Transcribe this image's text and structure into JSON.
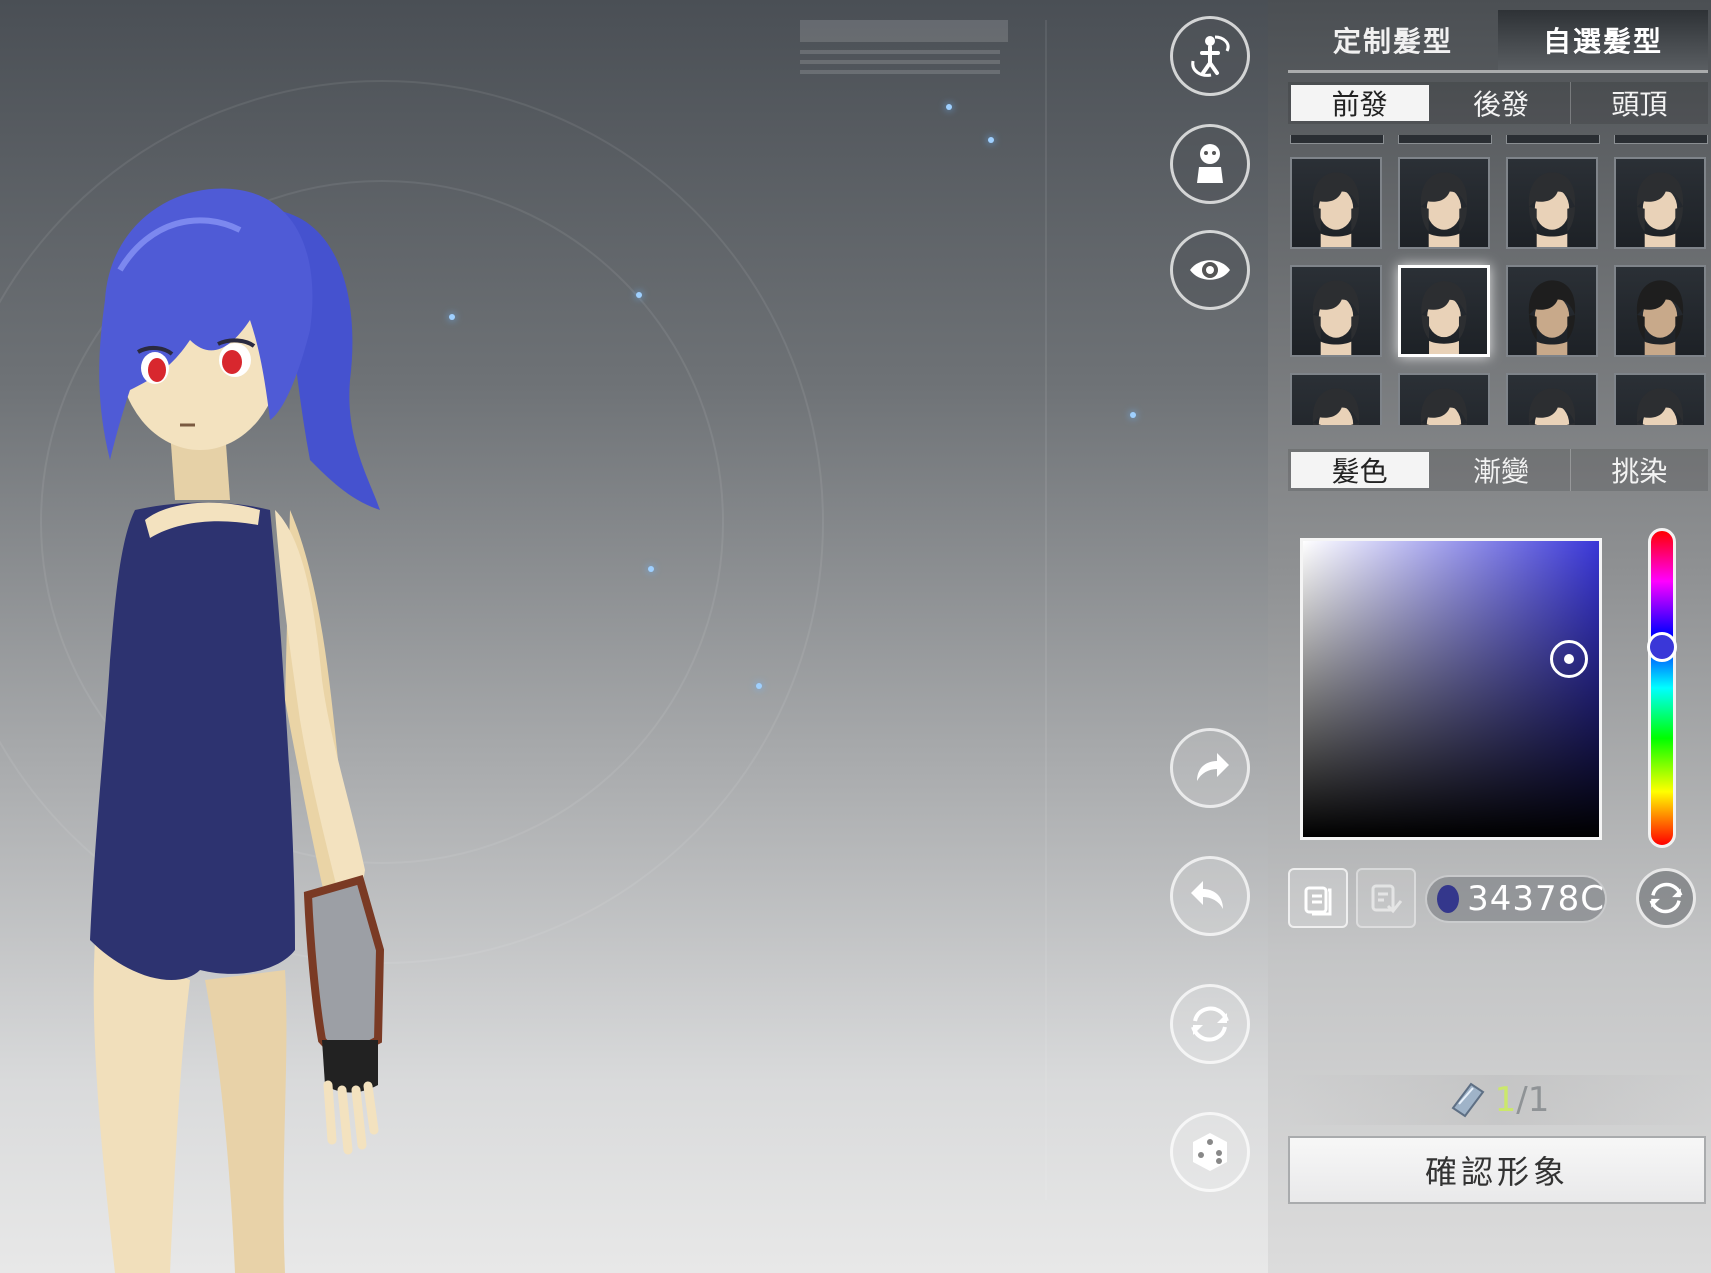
{
  "panel": {
    "top_tabs": [
      {
        "label": "定制髮型",
        "active": false
      },
      {
        "label": "自選髮型",
        "active": true
      }
    ],
    "part_tabs": [
      {
        "label": "前發",
        "active": true
      },
      {
        "label": "後發",
        "active": false
      },
      {
        "label": "頭頂",
        "active": false
      }
    ],
    "hairstyles": {
      "visible_rows": 2,
      "per_row": 4,
      "selected_index": 5,
      "styles": [
        "hairstyle-1",
        "hairstyle-2",
        "hairstyle-3",
        "hairstyle-4",
        "hairstyle-5",
        "hairstyle-6",
        "hairstyle-7",
        "hairstyle-8",
        "hairstyle-9",
        "hairstyle-10",
        "hairstyle-11",
        "hairstyle-12"
      ]
    },
    "color_tabs": [
      {
        "label": "髮色",
        "active": true
      },
      {
        "label": "漸變",
        "active": false
      },
      {
        "label": "挑染",
        "active": false
      }
    ],
    "color": {
      "hex": "34378C",
      "swatch": "#34378C",
      "hue_color": "#3a37d8",
      "saturation": 0.9,
      "value": 0.6,
      "hue_position": 0.37
    },
    "count": {
      "current": "1",
      "separator": "/",
      "total": "1"
    },
    "confirm_label": "確認形象"
  },
  "tools": {
    "top": [
      "rotate-pose-icon",
      "character-icon",
      "eye-icon"
    ],
    "bottom": [
      "redo-icon",
      "undo-icon",
      "reset-icon",
      "dice-icon"
    ]
  },
  "character": {
    "hair_color": "#4f5bd6",
    "eye_color": "#d8272e",
    "skin_color": "#f3e2bf",
    "swimsuit_color": "#2d3370"
  }
}
